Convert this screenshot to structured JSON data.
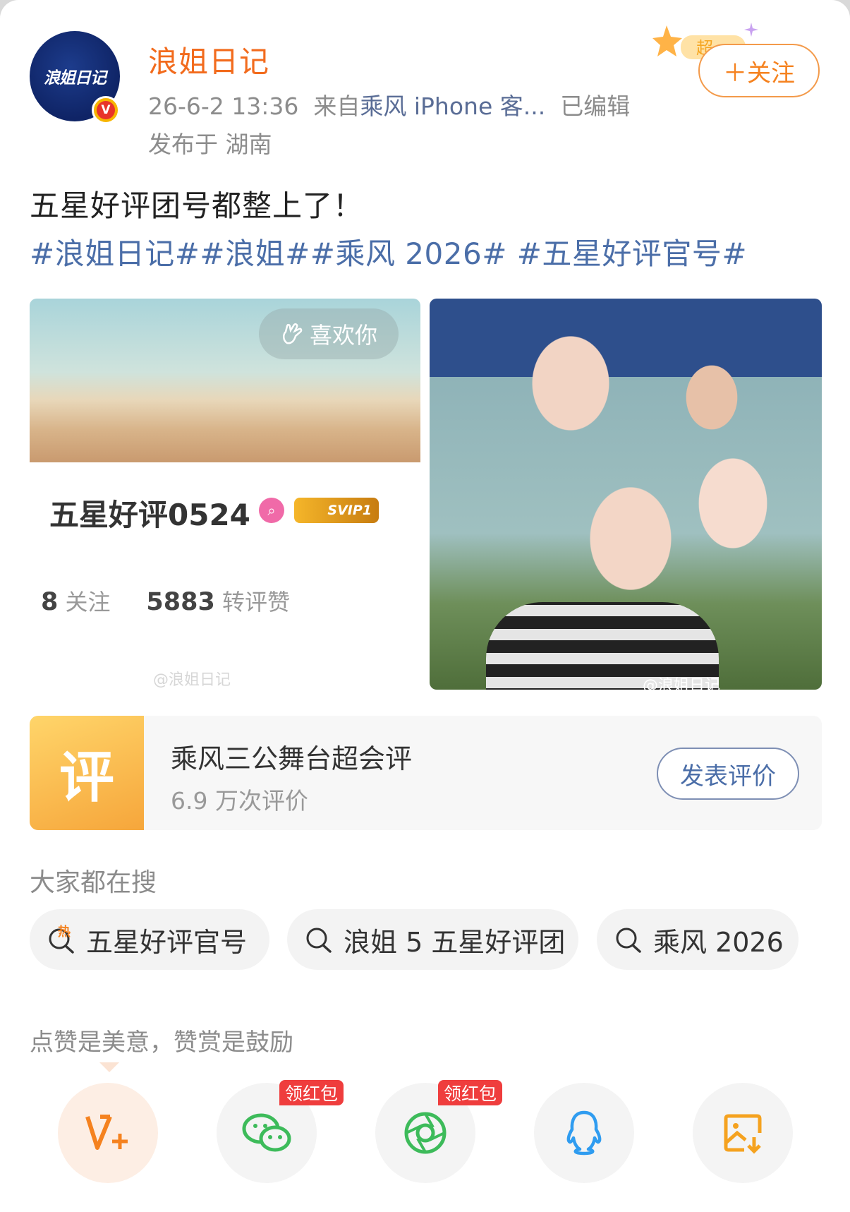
{
  "author": {
    "avatar_text": "浪姐日记",
    "verified_badge": "V",
    "name": "浪姐日记",
    "time": "26-6-2 13:36",
    "from_prefix": "来自",
    "from_source": "乘风 iPhone 客...",
    "edited": "已编辑",
    "location": "发布于 湖南"
  },
  "follow": {
    "label": "＋关注",
    "deco_text": "超"
  },
  "post": {
    "text": "五星好评团号都整上了！",
    "hashtags": "#浪姐日记##浪姐##乘风 2026# #五星好评官号#"
  },
  "image_left": {
    "pill": "喜欢你",
    "profile_name": "五星好评0524",
    "svip": "SVIP1",
    "follow_count": "8",
    "follow_label": "关注",
    "interact_count": "5883",
    "interact_label": "转评赞",
    "watermark": "@浪姐日记"
  },
  "image_right": {
    "watermark": "@浪姐日记"
  },
  "review": {
    "thumb": "评",
    "title": "乘风三公舞台超会评",
    "subtitle": "6.9 万次评价",
    "button": "发表评价"
  },
  "search": {
    "heading": "大家都在搜",
    "hot_mark": "热",
    "items": [
      "五星好评官号",
      "浪姐 5 五星好评团",
      "乘风 2026"
    ]
  },
  "tip": "点赞是美意，赞赏是鼓励",
  "share": {
    "badge": "领红包",
    "icons": [
      "reward-icon",
      "wechat-icon",
      "moments-icon",
      "qq-icon",
      "save-image-icon"
    ]
  },
  "colors": {
    "accent": "#f26b1d",
    "link": "#4b6ea8",
    "badge_red": "#ef3d3d"
  }
}
